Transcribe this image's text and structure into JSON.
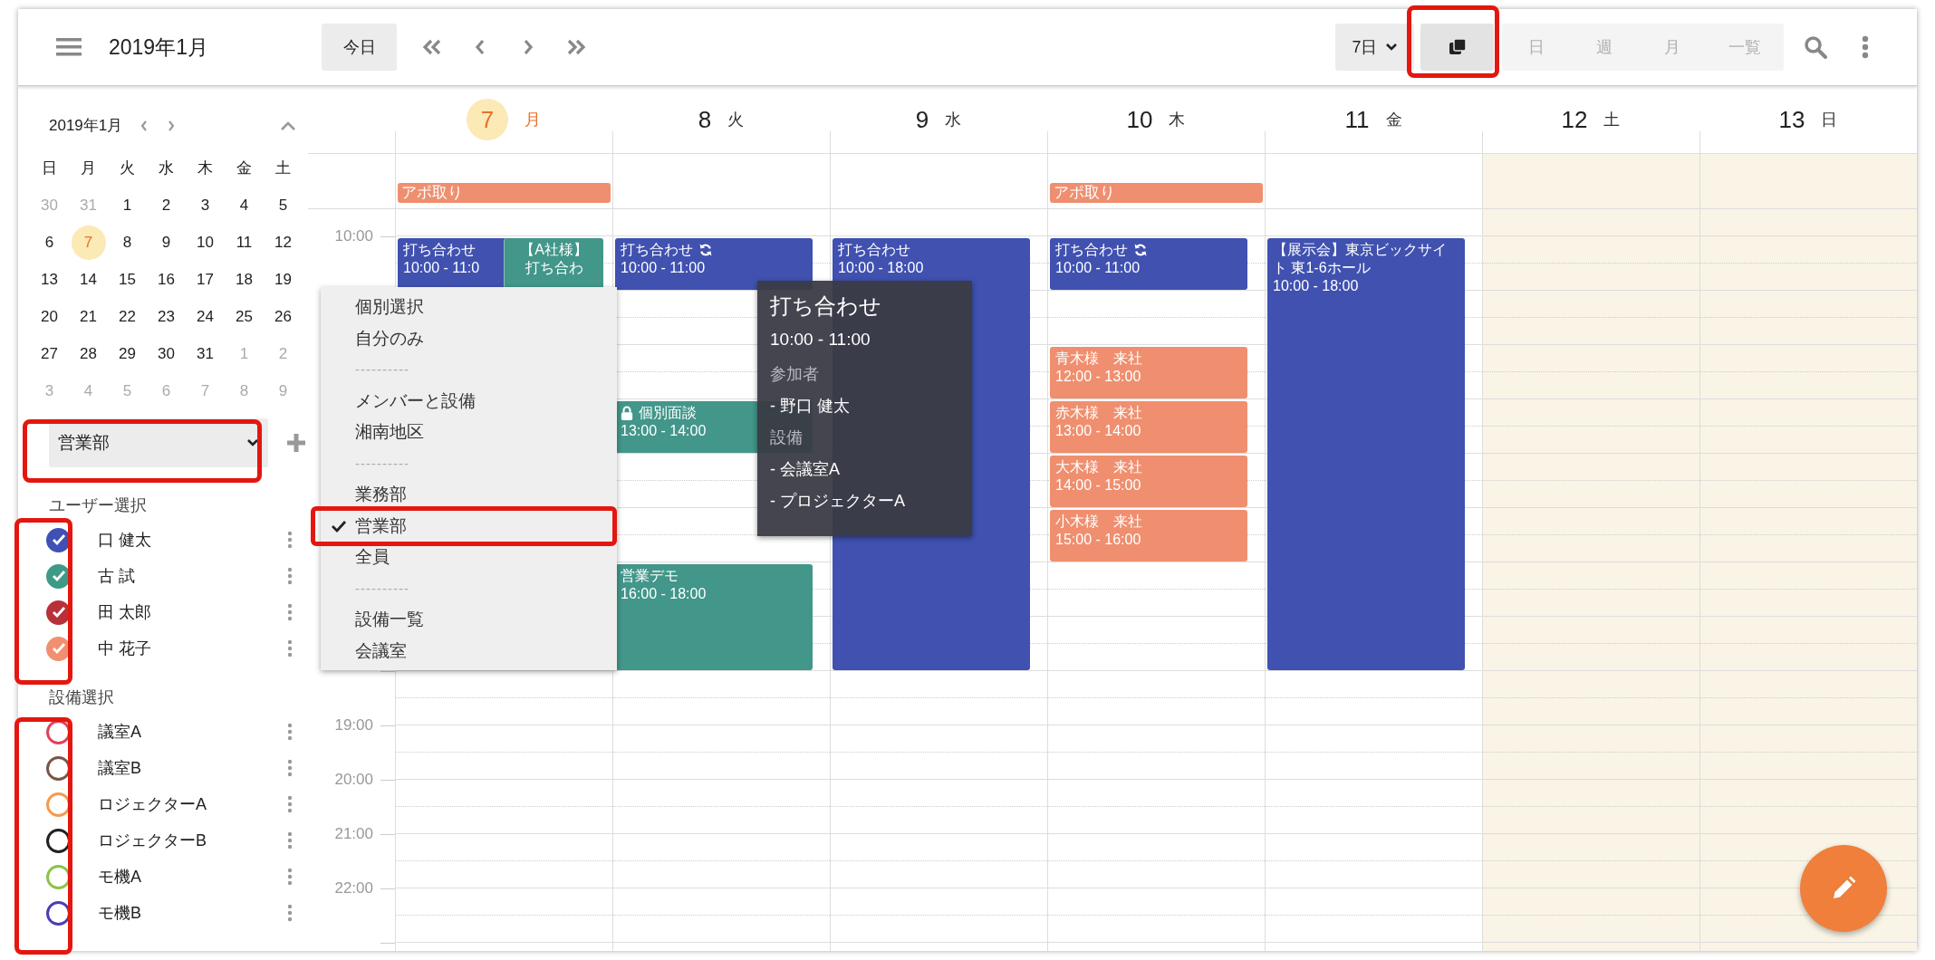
{
  "toolbar": {
    "title": "2019年1月",
    "today_button": "今日",
    "view_select": {
      "label": "7日"
    },
    "layered_toggle": {
      "on": true,
      "highlighted": true
    },
    "views": [
      {
        "label": "日",
        "disabled": true
      },
      {
        "label": "週",
        "disabled": true
      },
      {
        "label": "月",
        "disabled": true
      },
      {
        "label": "一覧",
        "disabled": true
      }
    ]
  },
  "mini_calendar": {
    "title": "2019年1月",
    "weekdays": [
      "日",
      "月",
      "火",
      "水",
      "木",
      "金",
      "土"
    ],
    "weeks": [
      [
        {
          "day": "30",
          "muted": true,
          "today": false
        },
        {
          "day": "31",
          "muted": true,
          "today": false
        },
        {
          "day": "1",
          "muted": false,
          "today": false
        },
        {
          "day": "2",
          "muted": false,
          "today": false
        },
        {
          "day": "3",
          "muted": false,
          "today": false
        },
        {
          "day": "4",
          "muted": false,
          "today": false
        },
        {
          "day": "5",
          "muted": false,
          "today": false
        }
      ],
      [
        {
          "day": "6",
          "muted": false,
          "today": false
        },
        {
          "day": "7",
          "muted": false,
          "today": true
        },
        {
          "day": "8",
          "muted": false,
          "today": false
        },
        {
          "day": "9",
          "muted": false,
          "today": false
        },
        {
          "day": "10",
          "muted": false,
          "today": false
        },
        {
          "day": "11",
          "muted": false,
          "today": false
        },
        {
          "day": "12",
          "muted": false,
          "today": false
        }
      ],
      [
        {
          "day": "13",
          "muted": false,
          "today": false
        },
        {
          "day": "14",
          "muted": false,
          "today": false
        },
        {
          "day": "15",
          "muted": false,
          "today": false
        },
        {
          "day": "16",
          "muted": false,
          "today": false
        },
        {
          "day": "17",
          "muted": false,
          "today": false
        },
        {
          "day": "18",
          "muted": false,
          "today": false
        },
        {
          "day": "19",
          "muted": false,
          "today": false
        }
      ],
      [
        {
          "day": "20",
          "muted": false,
          "today": false
        },
        {
          "day": "21",
          "muted": false,
          "today": false
        },
        {
          "day": "22",
          "muted": false,
          "today": false
        },
        {
          "day": "23",
          "muted": false,
          "today": false
        },
        {
          "day": "24",
          "muted": false,
          "today": false
        },
        {
          "day": "25",
          "muted": false,
          "today": false
        },
        {
          "day": "26",
          "muted": false,
          "today": false
        }
      ],
      [
        {
          "day": "27",
          "muted": false,
          "today": false
        },
        {
          "day": "28",
          "muted": false,
          "today": false
        },
        {
          "day": "29",
          "muted": false,
          "today": false
        },
        {
          "day": "30",
          "muted": false,
          "today": false
        },
        {
          "day": "31",
          "muted": false,
          "today": false
        },
        {
          "day": "1",
          "muted": true,
          "today": false
        },
        {
          "day": "2",
          "muted": true,
          "today": false
        }
      ],
      [
        {
          "day": "3",
          "muted": true,
          "today": false
        },
        {
          "day": "4",
          "muted": true,
          "today": false
        },
        {
          "day": "5",
          "muted": true,
          "today": false
        },
        {
          "day": "6",
          "muted": true,
          "today": false
        },
        {
          "day": "7",
          "muted": true,
          "today": false
        },
        {
          "day": "8",
          "muted": true,
          "today": false
        },
        {
          "day": "9",
          "muted": true,
          "today": false
        }
      ]
    ]
  },
  "group_select": {
    "value": "営業部",
    "highlighted": true
  },
  "user_section": {
    "title": "ユーザー選択",
    "highlighted": true,
    "items": [
      {
        "name": "口 健太",
        "checked": true,
        "color": "#3f51b5"
      },
      {
        "name": "古 試",
        "checked": true,
        "color": "#3e9a87"
      },
      {
        "name": "田 太郎",
        "checked": true,
        "color": "#b8313a"
      },
      {
        "name": "中 花子",
        "checked": true,
        "color": "#f09070"
      }
    ]
  },
  "equipment_section": {
    "title": "設備選択",
    "highlighted": true,
    "items": [
      {
        "name": "議室A",
        "checked": false,
        "color": "#e0435a"
      },
      {
        "name": "議室B",
        "checked": false,
        "color": "#795548"
      },
      {
        "name": "ロジェクターA",
        "checked": false,
        "color": "#f59a4e"
      },
      {
        "name": "ロジェクターB",
        "checked": false,
        "color": "#212121"
      },
      {
        "name": "モ機A",
        "checked": false,
        "color": "#8bc34a"
      },
      {
        "name": "モ機B",
        "checked": false,
        "color": "#4a3fb5"
      }
    ]
  },
  "time_labels": [
    "10:00",
    "19:00",
    "20:00",
    "21:00",
    "22:00"
  ],
  "days": [
    {
      "date": "7",
      "weekday": "月",
      "today": true,
      "weekend": false,
      "all_day": [
        {
          "title": "アポ取り",
          "color": "#ef8f6f"
        }
      ],
      "events": [
        {
          "kind": "normal",
          "title": "打ち合わせ",
          "time": "10:00 - 11:0",
          "color": "#4051b0"
        },
        {
          "kind": "side",
          "lines": [
            "【A社様】",
            "打ち合わ"
          ],
          "color": "#42968a"
        }
      ]
    },
    {
      "date": "8",
      "weekday": "火",
      "today": false,
      "weekend": false,
      "events": [
        {
          "kind": "recurring",
          "title": "打ち合わせ",
          "time": "10:00 - 11:00",
          "color": "#4051b0"
        },
        {
          "kind": "private",
          "title": "個別面談",
          "time": "13:00 - 14:00",
          "color": "#42968a"
        },
        {
          "kind": "normal",
          "title": "営業デモ",
          "time": "16:00 - 18:00",
          "color": "#42968a"
        }
      ]
    },
    {
      "date": "9",
      "weekday": "水",
      "today": false,
      "weekend": false,
      "events": [
        {
          "kind": "normal",
          "title": "打ち合わせ",
          "time": "10:00 - 18:00",
          "color": "#4051b0"
        }
      ]
    },
    {
      "date": "10",
      "weekday": "木",
      "today": false,
      "weekend": false,
      "all_day": [
        {
          "title": "アポ取り",
          "color": "#ef8f6f"
        }
      ],
      "events": [
        {
          "kind": "recurring",
          "title": "打ち合わせ",
          "time": "10:00 - 11:00",
          "color": "#4051b0"
        },
        {
          "kind": "normal",
          "title": "青木様　来社",
          "time": "12:00 - 13:00",
          "color": "#ef8f6f"
        },
        {
          "kind": "normal",
          "title": "赤木様　来社",
          "time": "13:00 - 14:00",
          "color": "#ef8f6f"
        },
        {
          "kind": "normal",
          "title": "大木様　来社",
          "time": "14:00 - 15:00",
          "color": "#ef8f6f"
        },
        {
          "kind": "normal",
          "title": "小木様　来社",
          "time": "15:00 - 16:00",
          "color": "#ef8f6f"
        }
      ]
    },
    {
      "date": "11",
      "weekday": "金",
      "today": false,
      "weekend": false,
      "events": [
        {
          "kind": "normal",
          "title": "【展示会】東京ビックサイト 東1-6ホール",
          "time": "10:00 - 18:00",
          "color": "#4051b0"
        }
      ]
    },
    {
      "date": "12",
      "weekday": "土",
      "today": false,
      "weekend": true
    },
    {
      "date": "13",
      "weekday": "日",
      "today": false,
      "weekend": true
    }
  ],
  "group_menu": [
    {
      "kind": "item",
      "label": "個別選択",
      "selected": false,
      "highlighted": false
    },
    {
      "kind": "item",
      "label": "自分のみ",
      "selected": false,
      "highlighted": false
    },
    {
      "kind": "separator",
      "label": "----------"
    },
    {
      "kind": "item",
      "label": "メンバーと設備",
      "selected": false,
      "highlighted": false
    },
    {
      "kind": "item",
      "label": "湘南地区",
      "selected": false,
      "highlighted": false
    },
    {
      "kind": "separator",
      "label": "----------"
    },
    {
      "kind": "item",
      "label": "業務部",
      "selected": false,
      "highlighted": false
    },
    {
      "kind": "item",
      "label": "営業部",
      "selected": true,
      "highlighted": true
    },
    {
      "kind": "item",
      "label": "全員",
      "selected": false,
      "highlighted": false
    },
    {
      "kind": "separator",
      "label": "----------"
    },
    {
      "kind": "item",
      "label": "設備一覧",
      "selected": false,
      "highlighted": false
    },
    {
      "kind": "item",
      "label": "会議室",
      "selected": false,
      "highlighted": false
    }
  ],
  "tooltip": {
    "title": "打ち合わせ",
    "time": "10:00 - 11:00",
    "sections": [
      {
        "kind": "heading",
        "text": "参加者"
      },
      {
        "kind": "entry",
        "text": "- 野口 健太"
      },
      {
        "kind": "heading",
        "text": "設備"
      },
      {
        "kind": "entry",
        "text": "- 会議室A"
      },
      {
        "kind": "entry",
        "text": "- プロジェクターA"
      }
    ]
  }
}
